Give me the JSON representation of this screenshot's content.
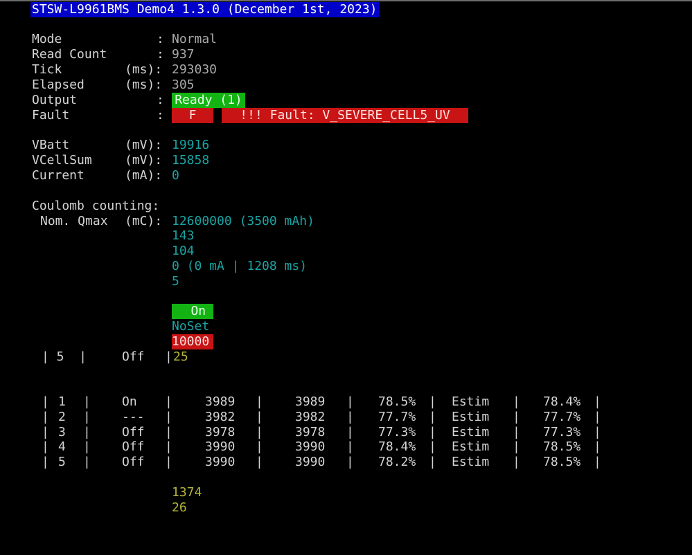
{
  "title": "STSW-L9961BMS Demo4 1.3.0 (December 1st, 2023)",
  "status": {
    "mode_label": "Mode",
    "mode_sep": ":",
    "mode_value": "Normal",
    "readcount_label": "Read Count",
    "readcount_sep": ":",
    "readcount_value": "937",
    "tick_label": "Tick",
    "tick_unit": "(ms):",
    "tick_value": "293030",
    "elapsed_label": "Elapsed",
    "elapsed_unit": "(ms):",
    "elapsed_value": "305",
    "output_label": "Output",
    "output_sep": ":",
    "output_value": "Ready (1)",
    "fault_label": "Fault",
    "fault_sep": ":",
    "fault_flag": "F",
    "fault_text": "!!! Fault: V_SEVERE_CELL5_UV"
  },
  "voltages": {
    "vbatt_label": "VBatt",
    "vbatt_unit": "(mV):",
    "vbatt_value": "19916",
    "vcellsum_label": "VCellSum",
    "vcellsum_unit": "(mV):",
    "vcellsum_value": "15858",
    "current_label": "Current",
    "current_unit": "(mA):",
    "current_value": "0"
  },
  "coulomb": {
    "header": "Coulomb counting:",
    "qmax_label": "Nom. Qmax",
    "qmax_unit": "(mC):",
    "qmax_value": "12600000 (3500 mAh)",
    "line2": "143",
    "line3": "104",
    "line4": "0 (0 mA | 1208 ms)",
    "line5": "5"
  },
  "balance": {
    "state": "On",
    "mode": "NoSet",
    "value": "10000"
  },
  "partial_row": {
    "lead": "| 5  |",
    "state": "Off",
    "bar": "|",
    "value": "25"
  },
  "cells": [
    {
      "idx": "1",
      "bal": "On",
      "v1": "3989",
      "v2": "3989",
      "soc": "78.5%",
      "type": "Estim",
      "soc2": "78.4%"
    },
    {
      "idx": "2",
      "bal": "---",
      "v1": "3982",
      "v2": "3982",
      "soc": "77.7%",
      "type": "Estim",
      "soc2": "77.7%"
    },
    {
      "idx": "3",
      "bal": "Off",
      "v1": "3978",
      "v2": "3978",
      "soc": "77.3%",
      "type": "Estim",
      "soc2": "77.3%"
    },
    {
      "idx": "4",
      "bal": "Off",
      "v1": "3990",
      "v2": "3990",
      "soc": "78.4%",
      "type": "Estim",
      "soc2": "78.5%"
    },
    {
      "idx": "5",
      "bal": "Off",
      "v1": "3990",
      "v2": "3990",
      "soc": "78.2%",
      "type": "Estim",
      "soc2": "78.5%"
    }
  ],
  "footer": {
    "line1": "1374",
    "line2": "26"
  }
}
